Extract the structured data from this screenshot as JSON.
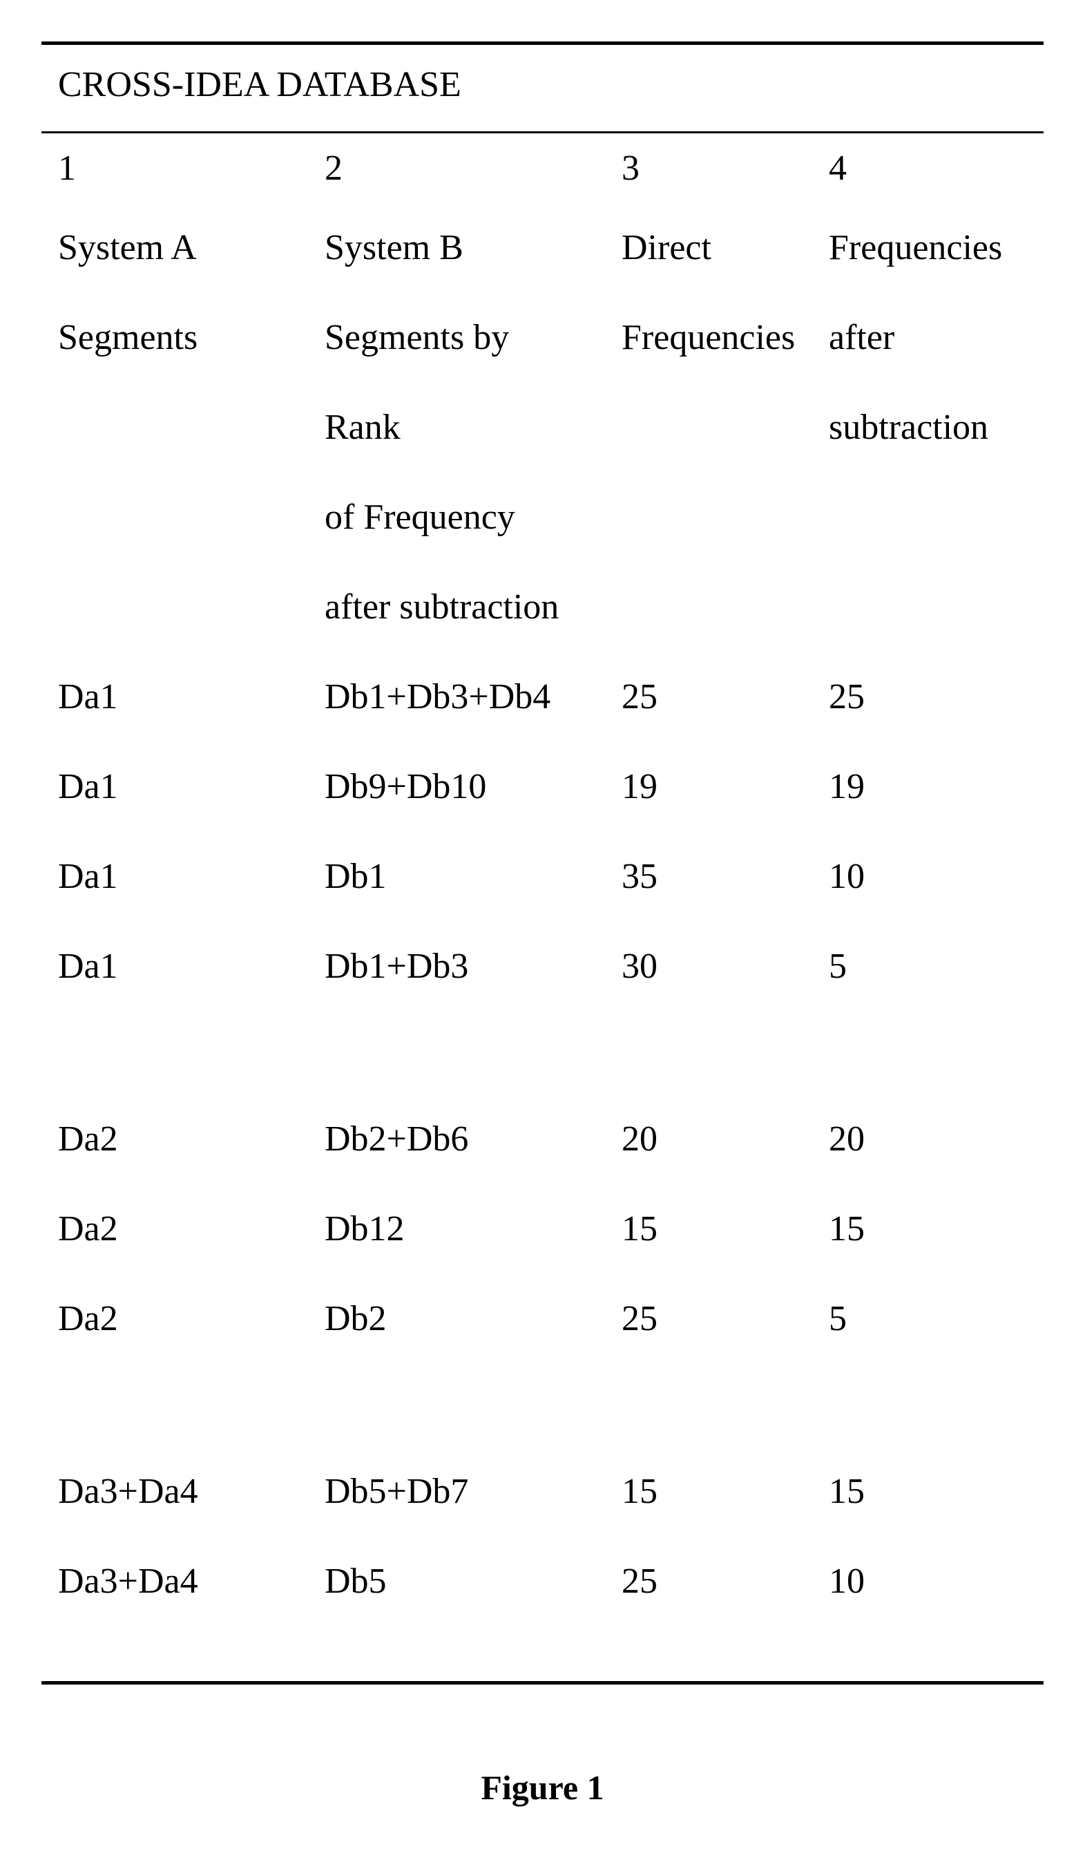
{
  "chart_data": {
    "type": "table",
    "title": "CROSS-IDEA DATABASE",
    "caption": "Figure 1",
    "columns": [
      {
        "number": "1",
        "lines": [
          "System A",
          "Segments"
        ]
      },
      {
        "number": "2",
        "lines": [
          "System B",
          "Segments by",
          "Rank",
          "of Frequency",
          "after subtraction"
        ]
      },
      {
        "number": "3",
        "lines": [
          "Direct",
          "Frequencies"
        ]
      },
      {
        "number": "4",
        "lines": [
          "Frequencies",
          "after",
          "subtraction"
        ]
      }
    ],
    "groups": [
      {
        "rows": [
          {
            "c1": "Da1",
            "c2": "Db1+Db3+Db4",
            "c3": "25",
            "c4": "25"
          },
          {
            "c1": "Da1",
            "c2": "Db9+Db10",
            "c3": "19",
            "c4": "19"
          },
          {
            "c1": "Da1",
            "c2": "Db1",
            "c3": "35",
            "c4": "10"
          },
          {
            "c1": "Da1",
            "c2": "Db1+Db3",
            "c3": "30",
            "c4": "5"
          }
        ]
      },
      {
        "rows": [
          {
            "c1": "Da2",
            "c2": "Db2+Db6",
            "c3": "20",
            "c4": "20"
          },
          {
            "c1": "Da2",
            "c2": "Db12",
            "c3": "15",
            "c4": "15"
          },
          {
            "c1": "Da2",
            "c2": "Db2",
            "c3": "25",
            "c4": "5"
          }
        ]
      },
      {
        "rows": [
          {
            "c1": "Da3+Da4",
            "c2": "Db5+Db7",
            "c3": "15",
            "c4": "15"
          },
          {
            "c1": "Da3+Da4",
            "c2": "Db5",
            "c3": "25",
            "c4": "10"
          }
        ]
      }
    ]
  }
}
